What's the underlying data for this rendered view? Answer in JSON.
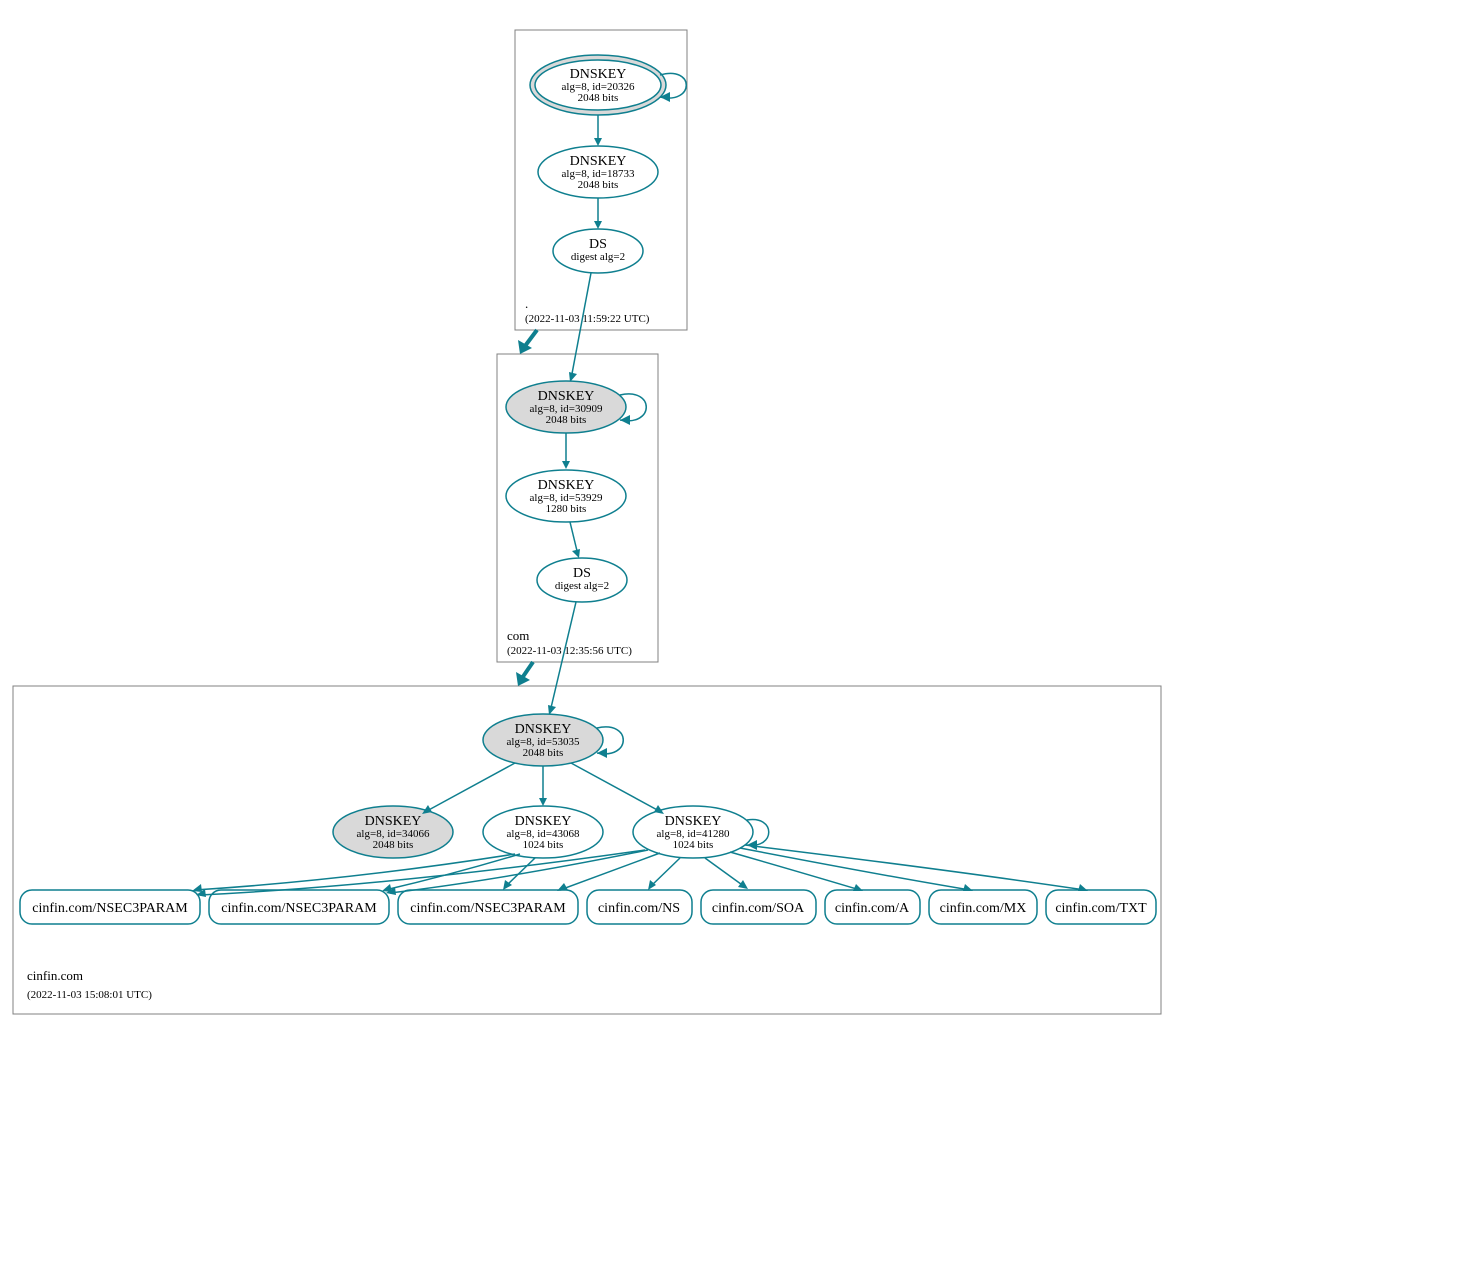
{
  "zones": {
    "root": {
      "label": ".",
      "timestamp": "(2022-11-03 11:59:22 UTC)"
    },
    "com": {
      "label": "com",
      "timestamp": "(2022-11-03 12:35:56 UTC)"
    },
    "cinfin": {
      "label": "cinfin.com",
      "timestamp": "(2022-11-03 15:08:01 UTC)"
    }
  },
  "nodes": {
    "root_ksk": {
      "title": "DNSKEY",
      "l1": "alg=8, id=20326",
      "l2": "2048 bits"
    },
    "root_zsk": {
      "title": "DNSKEY",
      "l1": "alg=8, id=18733",
      "l2": "2048 bits"
    },
    "root_ds": {
      "title": "DS",
      "l1": "digest alg=2"
    },
    "com_ksk": {
      "title": "DNSKEY",
      "l1": "alg=8, id=30909",
      "l2": "2048 bits"
    },
    "com_zsk": {
      "title": "DNSKEY",
      "l1": "alg=8, id=53929",
      "l2": "1280 bits"
    },
    "com_ds": {
      "title": "DS",
      "l1": "digest alg=2"
    },
    "cin_ksk": {
      "title": "DNSKEY",
      "l1": "alg=8, id=53035",
      "l2": "2048 bits"
    },
    "cin_k1": {
      "title": "DNSKEY",
      "l1": "alg=8, id=34066",
      "l2": "2048 bits"
    },
    "cin_k2": {
      "title": "DNSKEY",
      "l1": "alg=8, id=43068",
      "l2": "1024 bits"
    },
    "cin_k3": {
      "title": "DNSKEY",
      "l1": "alg=8, id=41280",
      "l2": "1024 bits"
    }
  },
  "rr": {
    "r1": "cinfin.com/NSEC3PARAM",
    "r2": "cinfin.com/NSEC3PARAM",
    "r3": "cinfin.com/NSEC3PARAM",
    "r4": "cinfin.com/NS",
    "r5": "cinfin.com/SOA",
    "r6": "cinfin.com/A",
    "r7": "cinfin.com/MX",
    "r8": "cinfin.com/TXT"
  }
}
